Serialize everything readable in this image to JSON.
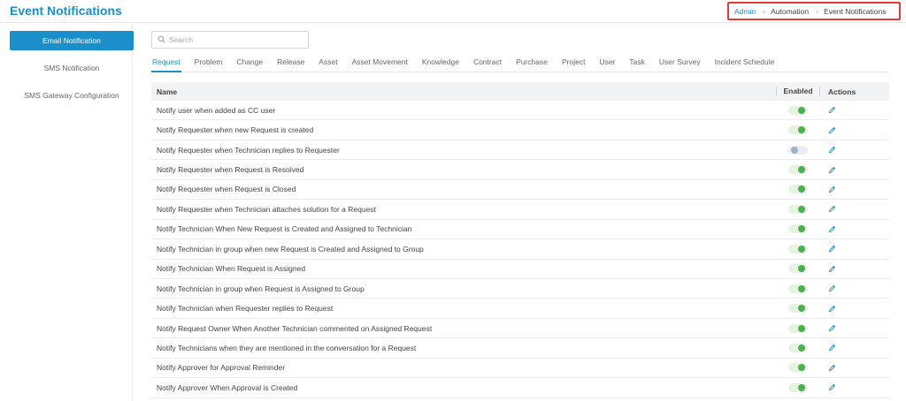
{
  "header": {
    "title": "Event Notifications",
    "breadcrumb": [
      "Admin",
      "Automation",
      "Event Notifications"
    ]
  },
  "sidebar": {
    "items": [
      {
        "label": "Email Notification",
        "active": true
      },
      {
        "label": "SMS Notification",
        "active": false
      },
      {
        "label": "SMS Gateway Configuration",
        "active": false
      }
    ]
  },
  "search": {
    "placeholder": "Search",
    "value": ""
  },
  "tabs": [
    "Request",
    "Problem",
    "Change",
    "Release",
    "Asset",
    "Asset Movement",
    "Knowledge",
    "Contract",
    "Purchase",
    "Project",
    "User",
    "Task",
    "User Survey",
    "Incident Schedule"
  ],
  "active_tab": "Request",
  "table": {
    "columns": [
      "Name",
      "Enabled",
      "Actions"
    ],
    "rows": [
      {
        "name": "Notify user when added as CC user",
        "enabled": true
      },
      {
        "name": "Notify Requester when new Request is created",
        "enabled": true
      },
      {
        "name": "Notify Requester when Technician replies to Requester",
        "enabled": false
      },
      {
        "name": "Notify Requester when Request is Resolved",
        "enabled": true
      },
      {
        "name": "Notify Requester when Request is Closed",
        "enabled": true
      },
      {
        "name": "Notify Requester when Technician attaches solution for a Request",
        "enabled": true
      },
      {
        "name": "Notify Technician When New Request is Created and Assigned to Technician",
        "enabled": true
      },
      {
        "name": "Notify Technician in group when new Request is Created and Assigned to Group",
        "enabled": true
      },
      {
        "name": "Notify Technician When Request is Assigned",
        "enabled": true
      },
      {
        "name": "Notify Technician in group when Request is Assigned to Group",
        "enabled": true
      },
      {
        "name": "Notify Technician when Requester replies to Request",
        "enabled": true
      },
      {
        "name": "Notify Request Owner When Another Technician commented on Assigned Request",
        "enabled": true
      },
      {
        "name": "Notify Technicians when they are mentioned in the conversation for a Request",
        "enabled": true
      },
      {
        "name": "Notify Approver for Approval Reminder",
        "enabled": true
      },
      {
        "name": "Notify Approver When Approval is Created",
        "enabled": true
      }
    ]
  },
  "colors": {
    "accent": "#1a8fc9",
    "highlight_border": "#e53935",
    "toggle_on": "#4caf50",
    "toggle_off": "#9db1c7"
  },
  "icons": {
    "search": "search-icon",
    "edit": "pencil-icon",
    "separator": "chevron-right-icon"
  }
}
